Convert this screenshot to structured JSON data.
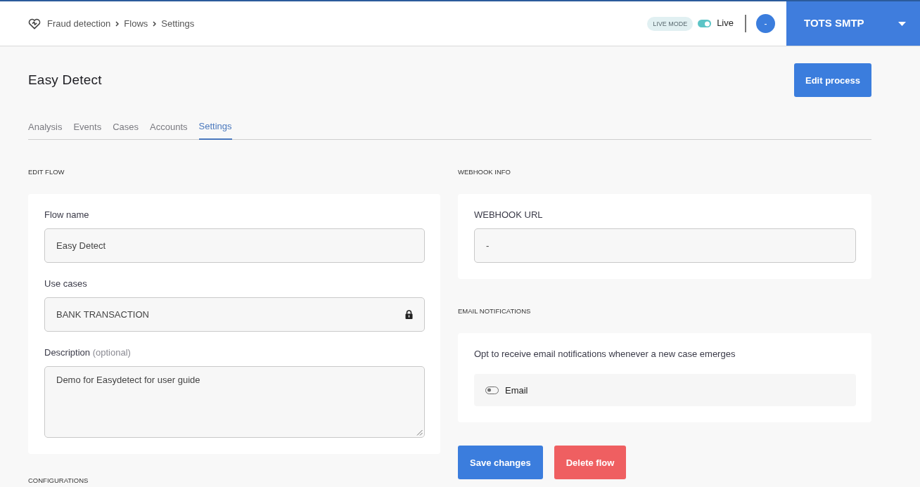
{
  "header": {
    "breadcrumb": [
      "Fraud detection",
      "Flows",
      "Settings"
    ],
    "mode_badge": "LIVE MODE",
    "live_toggle": {
      "label": "Live",
      "on": true
    },
    "avatar": "-",
    "account": "TOTS SMTP"
  },
  "page": {
    "title": "Easy Detect",
    "edit_button": "Edit process"
  },
  "tabs": [
    {
      "label": "Analysis",
      "selected": false
    },
    {
      "label": "Events",
      "selected": false
    },
    {
      "label": "Cases",
      "selected": false
    },
    {
      "label": "Accounts",
      "selected": false
    },
    {
      "label": "Settings",
      "selected": true
    }
  ],
  "edit_flow": {
    "heading": "EDIT FLOW",
    "fields": [
      {
        "kind": "text",
        "label": "Flow name",
        "value": "Easy Detect"
      },
      {
        "kind": "locked",
        "label": "Use cases",
        "value": "BANK TRANSACTION"
      },
      {
        "kind": "textarea",
        "label": "Description",
        "hint": "(optional)",
        "value": "Demo for Easydetect for user guide"
      }
    ]
  },
  "webhook_info": {
    "heading": "WEBHOOK INFO",
    "label": "WEBHOOK URL",
    "value": "-"
  },
  "email_notifications": {
    "heading": "EMAIL NOTIFICATIONS",
    "description": "Opt to receive email notifications whenever a new case emerges",
    "toggle": {
      "label": "Email",
      "on": false
    }
  },
  "actions": [
    {
      "kind": "primary",
      "label": "Save changes"
    },
    {
      "kind": "danger",
      "label": "Delete flow"
    }
  ],
  "configurations": {
    "heading": "CONFIGURATIONS"
  }
}
